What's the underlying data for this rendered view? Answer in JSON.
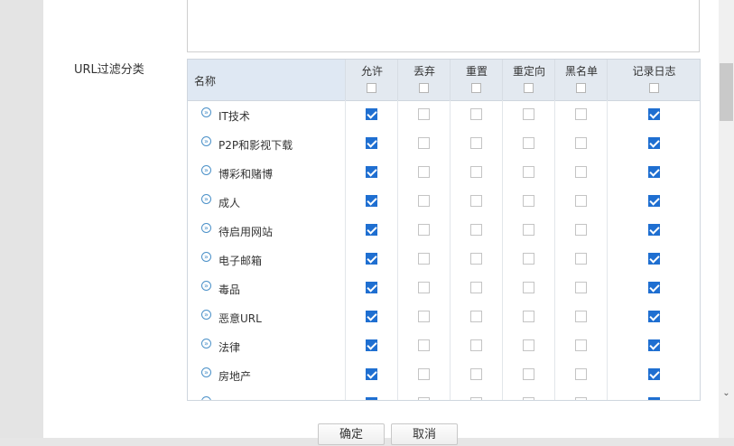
{
  "section_label": "URL过滤分类",
  "table": {
    "name_header": "名称",
    "action_headers": [
      "允许",
      "丢弃",
      "重置",
      "重定向",
      "黑名单",
      "记录日志"
    ],
    "rows": [
      {
        "name": "IT技术",
        "checks": [
          true,
          false,
          false,
          false,
          false,
          true
        ]
      },
      {
        "name": "P2P和影视下载",
        "checks": [
          true,
          false,
          false,
          false,
          false,
          true
        ]
      },
      {
        "name": "博彩和赌博",
        "checks": [
          true,
          false,
          false,
          false,
          false,
          true
        ]
      },
      {
        "name": "成人",
        "checks": [
          true,
          false,
          false,
          false,
          false,
          true
        ]
      },
      {
        "name": "待启用网站",
        "checks": [
          true,
          false,
          false,
          false,
          false,
          true
        ]
      },
      {
        "name": "电子邮箱",
        "checks": [
          true,
          false,
          false,
          false,
          false,
          true
        ]
      },
      {
        "name": "毒品",
        "checks": [
          true,
          false,
          false,
          false,
          false,
          true
        ]
      },
      {
        "name": "恶意URL",
        "checks": [
          true,
          false,
          false,
          false,
          false,
          true
        ]
      },
      {
        "name": "法律",
        "checks": [
          true,
          false,
          false,
          false,
          false,
          true
        ]
      },
      {
        "name": "房地产",
        "checks": [
          true,
          false,
          false,
          false,
          false,
          true
        ]
      },
      {
        "name": "",
        "checks": [
          true,
          false,
          false,
          false,
          false,
          true
        ]
      }
    ]
  },
  "buttons": {
    "ok": "确定",
    "cancel": "取消"
  },
  "colors": {
    "accent": "#1f6fd1",
    "header_bg": "#e3e9f0"
  }
}
